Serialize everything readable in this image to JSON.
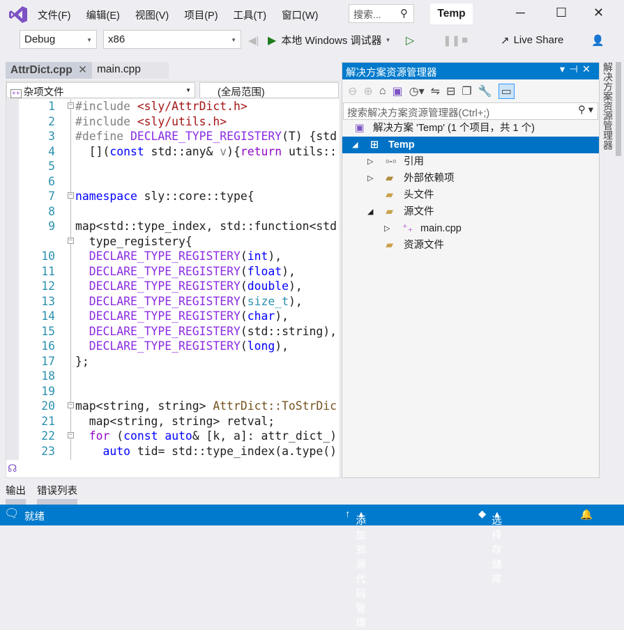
{
  "app": {
    "title": "Temp",
    "search_placeholder": "搜索...",
    "accent": "#007acc"
  },
  "menu": [
    "文件(F)",
    "编辑(E)",
    "视图(V)",
    "项目(P)",
    "工具(T)",
    "窗口(W)"
  ],
  "toolbar": {
    "config": "Debug",
    "platform": "x86",
    "run_label": "本地 Windows 调试器",
    "live_share": "Live Share"
  },
  "tabs": [
    {
      "label": "AttrDict.cpp",
      "active": true
    },
    {
      "label": "main.cpp",
      "active": false
    }
  ],
  "editor_nav": {
    "project": "杂项文件",
    "scope": "(全局范围)"
  },
  "code": [
    {
      "n": "1",
      "fold": true,
      "t": [
        [
          "#include ",
          "pp"
        ],
        [
          "<sly/AttrDict.h>",
          "str"
        ]
      ]
    },
    {
      "n": "2",
      "t": [
        [
          "#include ",
          "pp"
        ],
        [
          "<sly/utils.h>",
          "str"
        ]
      ]
    },
    {
      "n": "3",
      "t": [
        [
          "#define ",
          "pp"
        ],
        [
          "DECLARE_TYPE_REGISTERY",
          "mac"
        ],
        [
          "(T) {std",
          ""
        ]
      ]
    },
    {
      "n": "4",
      "t": [
        [
          "  [](",
          ""
        ],
        [
          "const",
          "kw"
        ],
        [
          " std::any& ",
          ""
        ],
        [
          "v",
          "par"
        ],
        [
          "){",
          ""
        ],
        [
          "return",
          "ctl"
        ],
        [
          " utils::",
          ""
        ]
      ]
    },
    {
      "n": "5",
      "t": []
    },
    {
      "n": "6",
      "t": []
    },
    {
      "n": "7",
      "fold": true,
      "t": [
        [
          "namespace",
          "kw"
        ],
        [
          " sly::core::type{",
          ""
        ]
      ]
    },
    {
      "n": "8",
      "t": []
    },
    {
      "n": "9",
      "t": [
        [
          "map<std::type_index, std::function<std",
          ""
        ]
      ]
    },
    {
      "n": "",
      "fold": true,
      "t": [
        [
          "  type_registery{",
          ""
        ]
      ]
    },
    {
      "n": "10",
      "t": [
        [
          "  ",
          ""
        ],
        [
          "DECLARE_TYPE_REGISTERY",
          "mac"
        ],
        [
          "(",
          ""
        ],
        [
          "int",
          "kw"
        ],
        [
          "),",
          ""
        ]
      ]
    },
    {
      "n": "11",
      "t": [
        [
          "  ",
          ""
        ],
        [
          "DECLARE_TYPE_REGISTERY",
          "mac"
        ],
        [
          "(",
          ""
        ],
        [
          "float",
          "kw"
        ],
        [
          "),",
          ""
        ]
      ]
    },
    {
      "n": "12",
      "t": [
        [
          "  ",
          ""
        ],
        [
          "DECLARE_TYPE_REGISTERY",
          "mac"
        ],
        [
          "(",
          ""
        ],
        [
          "double",
          "kw"
        ],
        [
          "),",
          ""
        ]
      ]
    },
    {
      "n": "13",
      "t": [
        [
          "  ",
          ""
        ],
        [
          "DECLARE_TYPE_REGISTERY",
          "mac"
        ],
        [
          "(",
          ""
        ],
        [
          "size_t",
          "typ"
        ],
        [
          "),",
          ""
        ]
      ]
    },
    {
      "n": "14",
      "t": [
        [
          "  ",
          ""
        ],
        [
          "DECLARE_TYPE_REGISTERY",
          "mac"
        ],
        [
          "(",
          ""
        ],
        [
          "char",
          "kw"
        ],
        [
          "),",
          ""
        ]
      ]
    },
    {
      "n": "15",
      "t": [
        [
          "  ",
          ""
        ],
        [
          "DECLARE_TYPE_REGISTERY",
          "mac"
        ],
        [
          "(std::string),",
          ""
        ]
      ]
    },
    {
      "n": "16",
      "t": [
        [
          "  ",
          ""
        ],
        [
          "DECLARE_TYPE_REGISTERY",
          "mac"
        ],
        [
          "(",
          ""
        ],
        [
          "long",
          "kw"
        ],
        [
          "),",
          ""
        ]
      ]
    },
    {
      "n": "17",
      "t": [
        [
          "};",
          ""
        ]
      ]
    },
    {
      "n": "18",
      "t": []
    },
    {
      "n": "19",
      "t": []
    },
    {
      "n": "20",
      "fold": true,
      "t": [
        [
          "map<string, string> ",
          ""
        ],
        [
          "AttrDict::ToStrDic",
          "fn"
        ]
      ]
    },
    {
      "n": "21",
      "t": [
        [
          "  map<string, string> retval;",
          ""
        ]
      ]
    },
    {
      "n": "22",
      "fold": true,
      "t": [
        [
          "  ",
          ""
        ],
        [
          "for",
          "ctl"
        ],
        [
          " (",
          ""
        ],
        [
          "const",
          "kw"
        ],
        [
          " ",
          ""
        ],
        [
          "auto",
          "kw"
        ],
        [
          "& [k, a]: attr_dict_)",
          ""
        ]
      ]
    },
    {
      "n": "23",
      "t": [
        [
          "    ",
          ""
        ],
        [
          "auto",
          "kw"
        ],
        [
          " tid= std::type_index(a.type()",
          ""
        ]
      ]
    }
  ],
  "solution_explorer": {
    "title": "解决方案资源管理器",
    "search_placeholder": "搜索解决方案资源管理器(Ctrl+;)",
    "side_tab": "解决方案资源管理器",
    "items": [
      {
        "label": "解决方案 'Temp' (1 个项目，共 1 个)",
        "icon": "solution-icon",
        "level": 0
      },
      {
        "label": "Temp",
        "icon": "project-icon",
        "level": 0,
        "expanded": true,
        "selected": true
      },
      {
        "label": "引用",
        "icon": "references-icon",
        "level": 1,
        "expander": "collapsed"
      },
      {
        "label": "外部依赖项",
        "icon": "external-deps-icon",
        "level": 1,
        "expander": "collapsed"
      },
      {
        "label": "头文件",
        "icon": "filter-folder-icon",
        "level": 1
      },
      {
        "label": "源文件",
        "icon": "filter-folder-icon",
        "level": 1,
        "expander": "expanded"
      },
      {
        "label": "main.cpp",
        "icon": "cpp-file-icon",
        "level": 2,
        "expander": "collapsed"
      },
      {
        "label": "资源文件",
        "icon": "filter-folder-icon",
        "level": 1
      }
    ]
  },
  "bottom_tabs": [
    "输出",
    "错误列表"
  ],
  "status": {
    "ready": "就绪",
    "source_control": "添加到源代码管理",
    "repo": "选择存储库"
  }
}
